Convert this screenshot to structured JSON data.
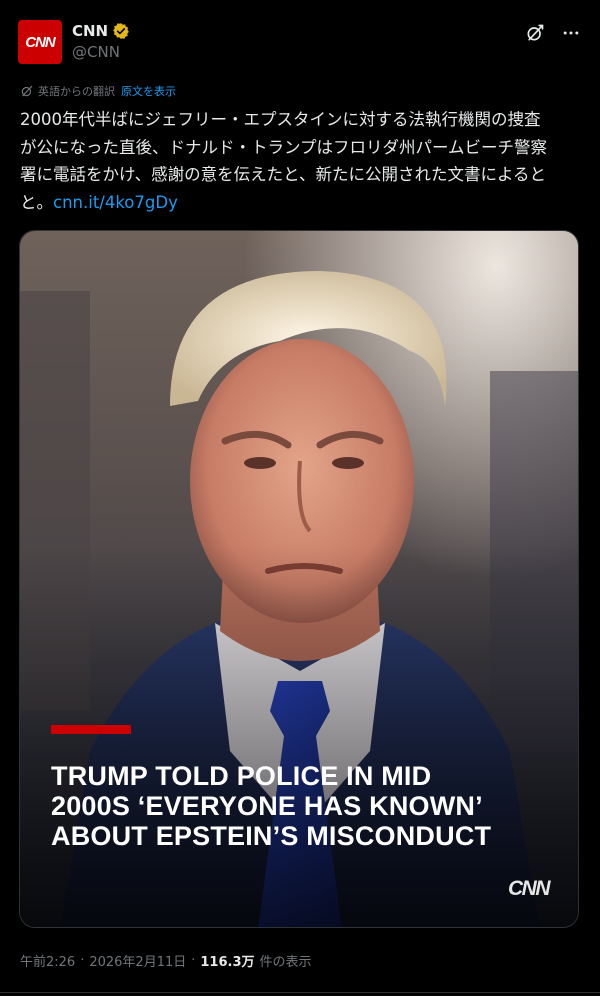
{
  "author": {
    "display_name": "CNN",
    "handle": "@CNN",
    "avatar_text": "CNN",
    "verified": true,
    "verified_color": "#e2b719",
    "avatar_color": "#cc0000"
  },
  "header_actions": {
    "grok_icon": "grok-icon",
    "more_icon": "more-icon",
    "more_glyph": "···"
  },
  "translation": {
    "label": "英語からの翻訳",
    "show_original": "原文を表示"
  },
  "tweet": {
    "text": "2000年代半ばにジェフリー・エプスタインに対する法執行機関の捜査\nが公になった直後、ドナルド・トランプはフロリダ州パームビーチ警察\n署に電話をかけ、感謝の意を伝えたと、新たに公開された文書によると\nと。",
    "link": "cnn.it/4ko7gDy",
    "link_color": "#1d9bf0"
  },
  "media": {
    "headline_lines": [
      "TRUMP TOLD POLICE IN MID",
      "2000S ‘EVERYONE HAS KNOWN’",
      "ABOUT EPSTEIN’S MISCONDUCT"
    ],
    "watermark": "CNN",
    "accent_bar_color": "#cc0000"
  },
  "meta": {
    "time": "午前2:26",
    "separator": "·",
    "date": "2026年2月11日",
    "separator2": "·",
    "views": "116.3万",
    "views_label": "件の表示"
  }
}
